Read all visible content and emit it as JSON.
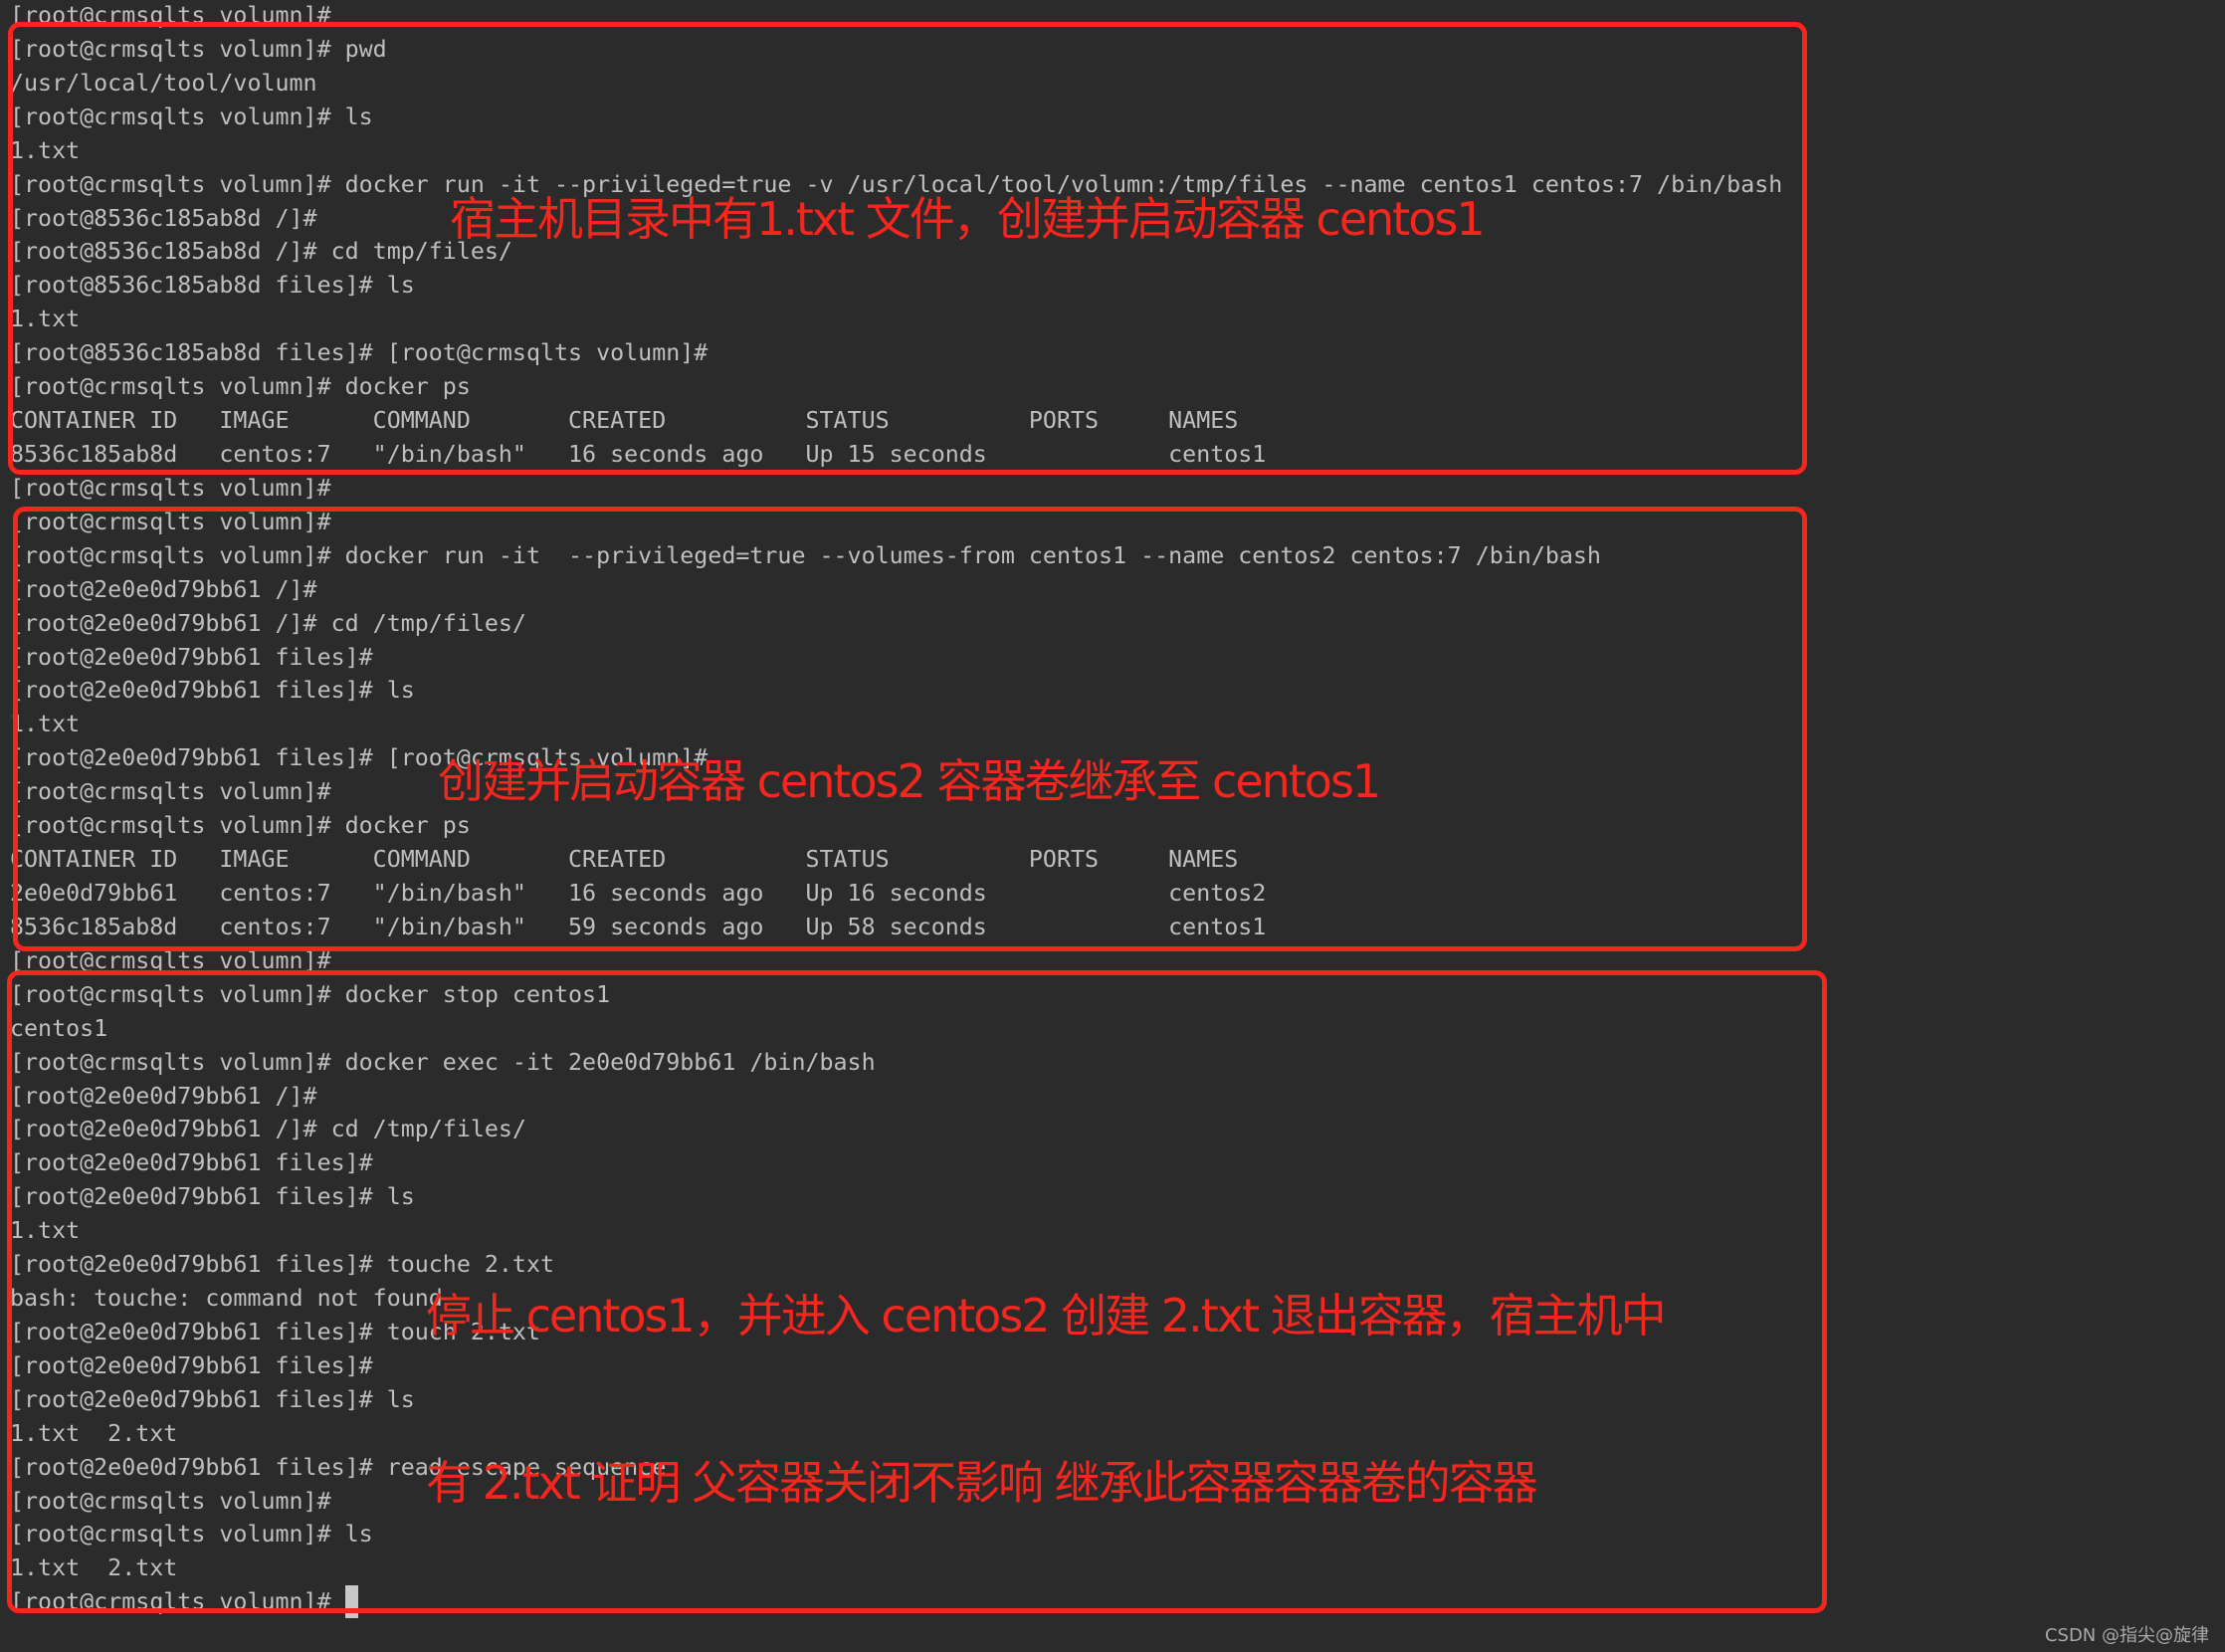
{
  "terminal": {
    "lines": [
      "[root@crmsqlts volumn]#",
      "[root@crmsqlts volumn]# pwd",
      "/usr/local/tool/volumn",
      "[root@crmsqlts volumn]# ls",
      "1.txt",
      "[root@crmsqlts volumn]# docker run -it --privileged=true -v /usr/local/tool/volumn:/tmp/files --name centos1 centos:7 /bin/bash",
      "[root@8536c185ab8d /]#",
      "[root@8536c185ab8d /]# cd tmp/files/",
      "[root@8536c185ab8d files]# ls",
      "1.txt",
      "[root@8536c185ab8d files]# [root@crmsqlts volumn]#",
      "[root@crmsqlts volumn]# docker ps",
      "CONTAINER ID   IMAGE      COMMAND       CREATED          STATUS          PORTS     NAMES",
      "8536c185ab8d   centos:7   \"/bin/bash\"   16 seconds ago   Up 15 seconds             centos1",
      "[root@crmsqlts volumn]#",
      "[root@crmsqlts volumn]#",
      "[root@crmsqlts volumn]# docker run -it  --privileged=true --volumes-from centos1 --name centos2 centos:7 /bin/bash",
      "[root@2e0e0d79bb61 /]#",
      "[root@2e0e0d79bb61 /]# cd /tmp/files/",
      "[root@2e0e0d79bb61 files]#",
      "[root@2e0e0d79bb61 files]# ls",
      "1.txt",
      "[root@2e0e0d79bb61 files]# [root@crmsqlts volumn]#",
      "[root@crmsqlts volumn]#",
      "[root@crmsqlts volumn]# docker ps",
      "CONTAINER ID   IMAGE      COMMAND       CREATED          STATUS          PORTS     NAMES",
      "2e0e0d79bb61   centos:7   \"/bin/bash\"   16 seconds ago   Up 16 seconds             centos2",
      "8536c185ab8d   centos:7   \"/bin/bash\"   59 seconds ago   Up 58 seconds             centos1",
      "[root@crmsqlts volumn]#",
      "[root@crmsqlts volumn]# docker stop centos1",
      "centos1",
      "[root@crmsqlts volumn]# docker exec -it 2e0e0d79bb61 /bin/bash",
      "[root@2e0e0d79bb61 /]#",
      "[root@2e0e0d79bb61 /]# cd /tmp/files/",
      "[root@2e0e0d79bb61 files]#",
      "[root@2e0e0d79bb61 files]# ls",
      "1.txt",
      "[root@2e0e0d79bb61 files]# touche 2.txt",
      "bash: touche: command not found",
      "[root@2e0e0d79bb61 files]# touch 2.txt",
      "[root@2e0e0d79bb61 files]#",
      "[root@2e0e0d79bb61 files]# ls",
      "1.txt  2.txt",
      "[root@2e0e0d79bb61 files]# read escape sequence",
      "[root@crmsqlts volumn]#",
      "[root@crmsqlts volumn]# ls",
      "1.txt  2.txt",
      "[root@crmsqlts volumn]# "
    ],
    "cursor_visible": true
  },
  "annotations": [
    {
      "lines": [
        "宿主机目录中有1.txt 文件，创建并启动容器 centos1"
      ]
    },
    {
      "lines": [
        "创建并启动容器 centos2 容器卷继承至 centos1"
      ]
    },
    {
      "lines": [
        "停止 centos1，并进入 centos2 创建 2.txt 退出容器，宿主机中",
        "有 2.txt 证明 父容器关闭不影响 继承此容器容器卷的容器"
      ]
    }
  ],
  "colors": {
    "background": "#2b2b2b",
    "text": "#bfbfbf",
    "highlight": "#f5261e",
    "cursor": "#c8c8c8"
  },
  "watermark": "CSDN @指尖@旋律"
}
